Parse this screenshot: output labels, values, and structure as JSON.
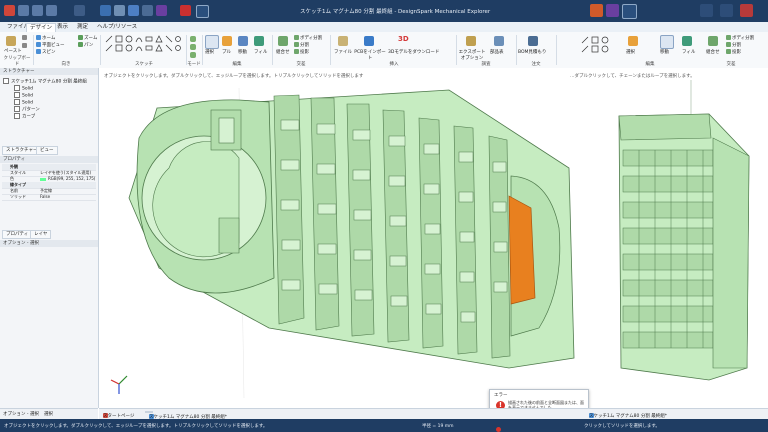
{
  "window": {
    "title": "スケッチ1ム  マグナム80 分割 最終組 - DesignSpark Mechanical Explorer"
  },
  "tabs": [
    "ファイル",
    "デザイン",
    "表示",
    "測定",
    "ヘルプ/リソース"
  ],
  "active_tab_index": 1,
  "ribbon": {
    "clipboard": {
      "paste": "ペースト",
      "group": "クリップボード"
    },
    "orient": {
      "home": "ホーム",
      "plane_view": "平面ビュー",
      "zoom": "ズーム",
      "pan": "パン",
      "spin": "スピン",
      "group": "向き"
    },
    "sketch": {
      "group": "スケッチ"
    },
    "mode": {
      "group": "モード"
    },
    "edit": {
      "select": "選択",
      "pull": "プル",
      "move": "移動",
      "fill": "フィル",
      "group": "編集"
    },
    "intersect": {
      "combine": "組合せ",
      "split_body": "ボディ分割",
      "split": "分割",
      "projection": "投影",
      "group": "交差"
    },
    "insert": {
      "file": "ファイル",
      "pcb": "PCBをインポート",
      "model": "3Dモデルをダウンロード",
      "group": "挿入"
    },
    "investigate": {
      "export": "エクスポートオプション",
      "parts": "部品表",
      "group": "調査"
    },
    "order": {
      "bom": "BOM見積もり",
      "group": "注文"
    }
  },
  "hints": {
    "left": "オブジェクトをクリックします。ダブルクリックして、エッジループを選択します。トリプルクリックしてソリッドを選択します",
    "right": "…ダブルクリックして、チェーンまたはループを選択します。"
  },
  "structure_panel": {
    "header": "ストラクチャー",
    "root": "スケッチ1ム  マグナム80 分割 最終組",
    "items": [
      "Solid",
      "Solid",
      "Solid",
      "パターン",
      "カーブ"
    ]
  },
  "panel_tabs": {
    "structure": "ストラクチャー",
    "view": "ビュー"
  },
  "properties": {
    "header": "プロパティ",
    "section_appearance": "外観",
    "style_label": "スタイル",
    "style_value": "レイヤを使う(スタイル適用)",
    "color_label": "色",
    "color_value": "RGB(99, 255, 152, 175)",
    "section_line": "線タイプ",
    "line_label": "名前",
    "line_value": "予定線",
    "weight_label": "ソリッド",
    "weight_value": "False"
  },
  "bottom_left_tabs": {
    "properties": "プロパティ",
    "layers": "レイヤ"
  },
  "options_header": "オプション - 選択",
  "option_tabs": {
    "options": "オプション - 選択",
    "select": "選択"
  },
  "doc_tabs": {
    "start": "スタートページ",
    "doc": "スケッチ1ム  マグナム80 分割 最終組*"
  },
  "status": {
    "left": "オブジェクトをクリックします。ダブルクリックして、エッジループを選択します。トリプルクリックしてソリッドを選択します。",
    "dist": "半径 = 19 mm",
    "right": "クリックしてソリッドを選択します。"
  },
  "error_popup": {
    "title": "エラー",
    "icon": "!",
    "message": "描画された後の前面と全断面図または、面を表示できませんでした。"
  },
  "colors": {
    "titlebar": "#1f3d63",
    "model_green": "#c6ecc1",
    "model_dark": "#8fc58d",
    "highlight_orange": "#e8801f"
  }
}
